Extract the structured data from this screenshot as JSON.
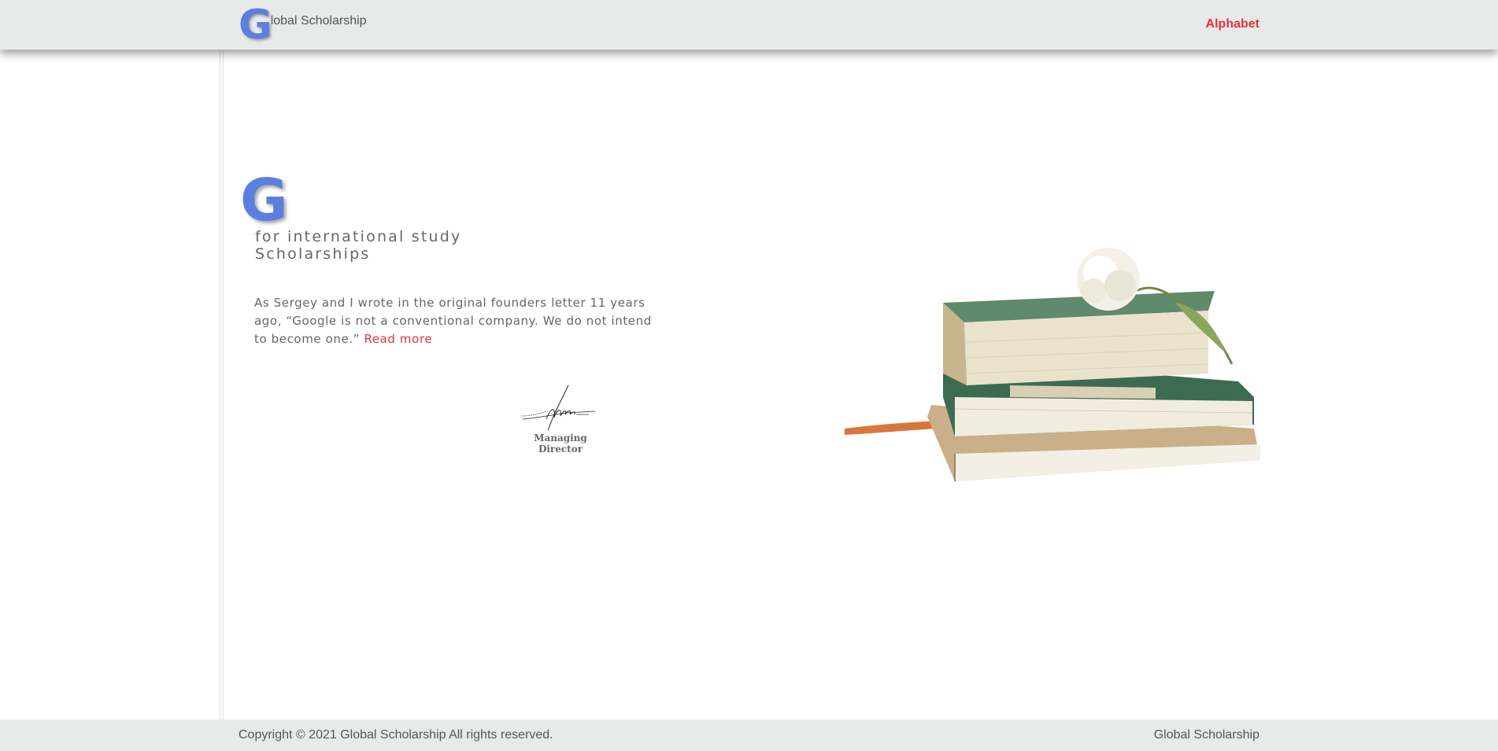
{
  "header": {
    "brand_letter": "G",
    "brand_text": "lobal Scholarship",
    "nav_link": "Alphabet",
    "brand_color": "#5b7fe0",
    "accent_color": "#e2333a"
  },
  "hero": {
    "logo_letter": "G",
    "tagline_line1": "for international study",
    "tagline_line2": "Scholarships",
    "quote_text": "As Sergey and I wrote in the original founders letter 11 years ago, “Google is not a conventional company. We do not intend to become one.” ",
    "read_more": "Read more",
    "signature_caption": "Managing Director",
    "signature_icon": "handwritten-signature",
    "image_icon": "stacked-books-with-flower"
  },
  "footer": {
    "copyright_prefix": "Copyright ",
    "copyright_symbol": "©",
    "copyright_text": " 2021 Global Scholarship All rights reserved.",
    "right_link": "Global Scholarship"
  }
}
